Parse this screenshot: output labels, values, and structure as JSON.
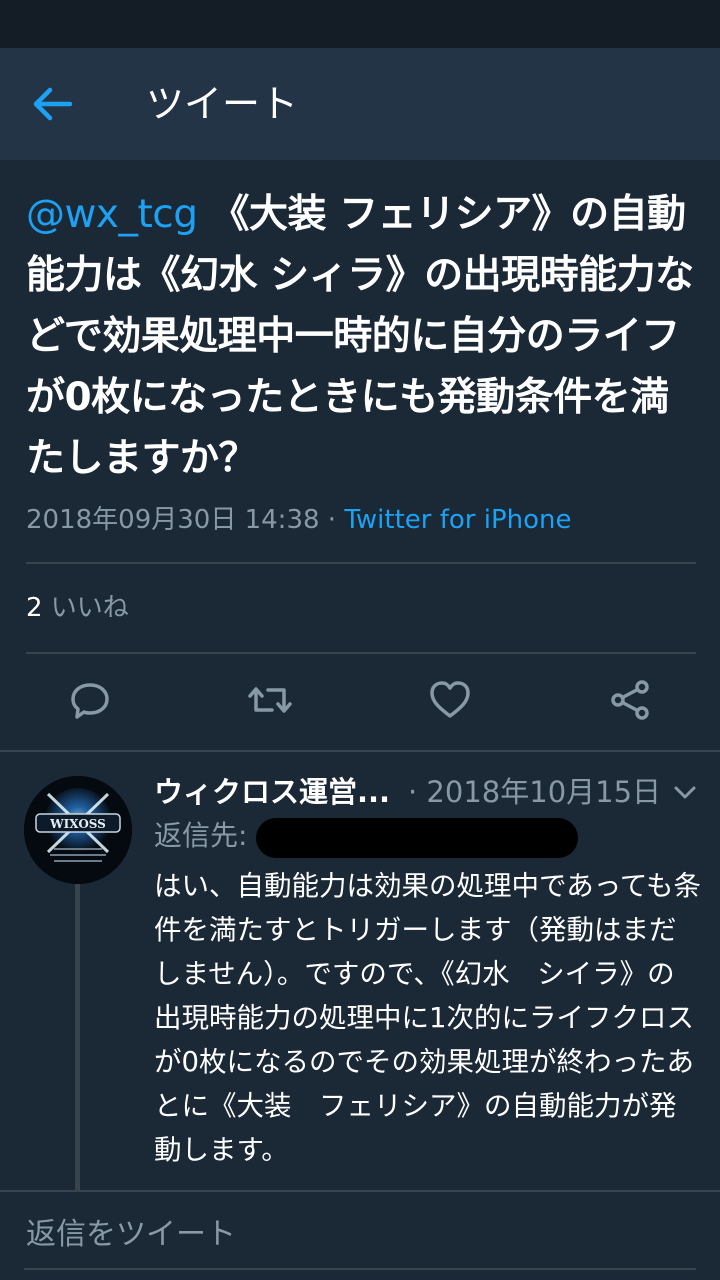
{
  "header": {
    "title": "ツイート"
  },
  "tweet": {
    "mention": "@wx_tcg",
    "text": " 《大装 フェリシア》の自動能力は《幻水 シィラ》の出現時能力などで効果処理中一時的に自分のライフが0枚になったときにも発動条件を満たしますか？",
    "timestamp": "2018年09月30日 14:38",
    "separator": " · ",
    "source": "Twitter for iPhone",
    "likes_count": "2",
    "likes_label": " いいね"
  },
  "reply": {
    "name": "ウィクロス運営...",
    "date": "· 2018年10月15日",
    "reply_to_label": "返信先:",
    "text": "はい、自動能力は効果の処理中であっても条件を満たすとトリガーします（発動はまだしません）。ですので、《幻水　シイラ》の出現時能力の処理中に1次的にライフクロスが0枚になるのでその効果処理が終わったあとに《大装　フェリシア》の自動能力が発動します。",
    "avatar_logo": "WIXOSS"
  },
  "compose": {
    "placeholder": "返信をツイート"
  },
  "colors": {
    "accent": "#1da1f2",
    "background": "#1b2836",
    "header": "#243447",
    "secondary_text": "#8899a6"
  },
  "icons": [
    "back-arrow-icon",
    "reply-icon",
    "retweet-icon",
    "like-icon",
    "share-icon",
    "chevron-down-icon"
  ]
}
